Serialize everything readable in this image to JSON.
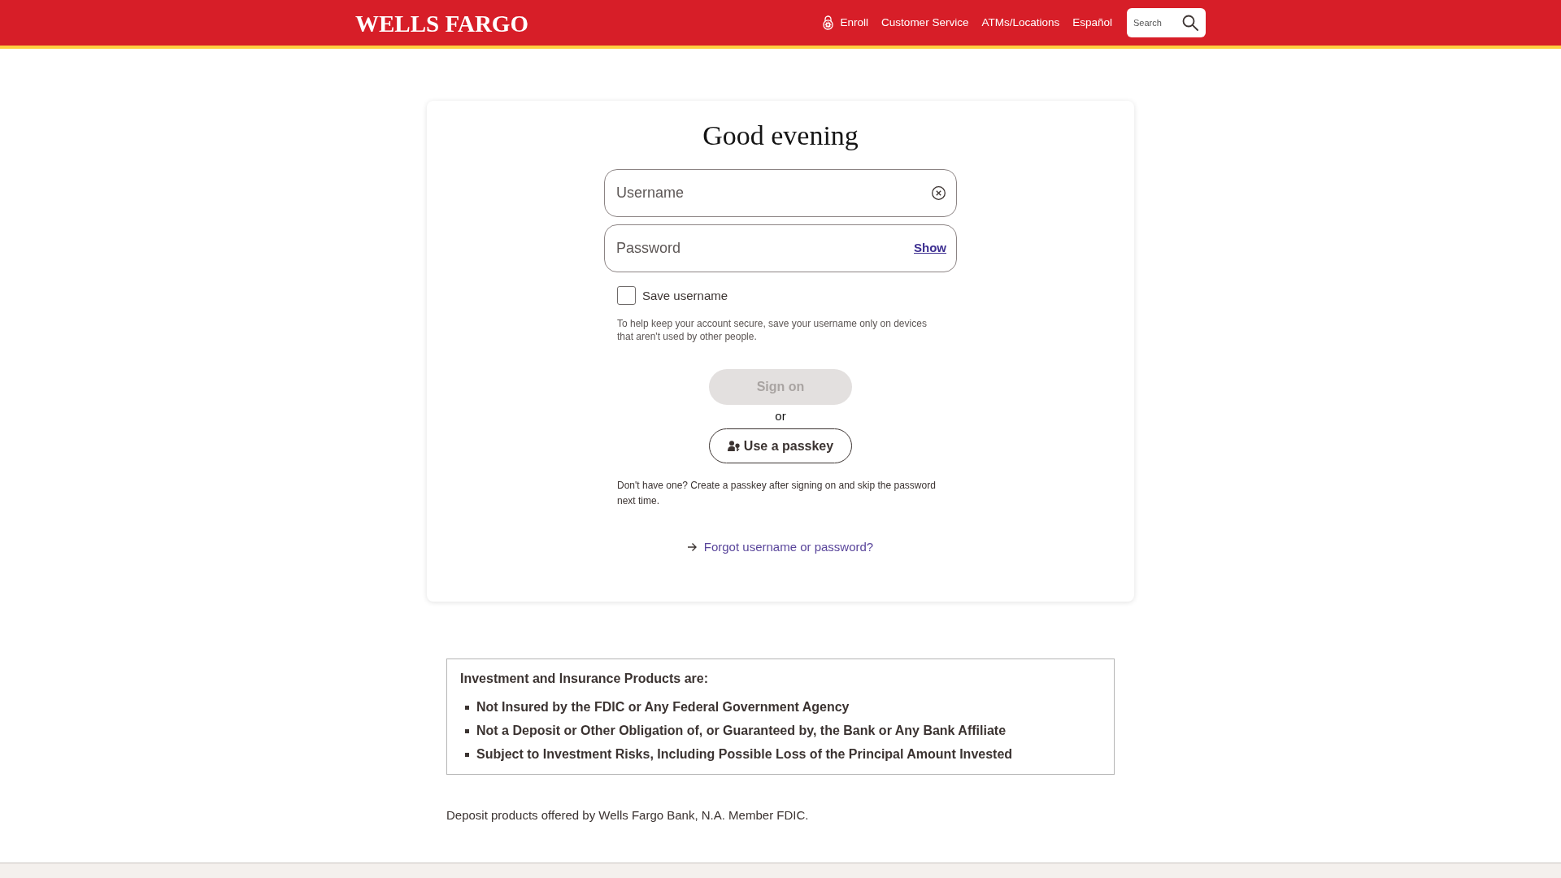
{
  "header": {
    "logo": "WELLS FARGO",
    "nav": [
      {
        "label": "Enroll",
        "kind": "icon"
      },
      {
        "label": "Customer Service",
        "kind": "text"
      },
      {
        "label": "ATMs/Locations",
        "kind": "text"
      },
      {
        "label": "Español",
        "kind": "text"
      }
    ],
    "search": {
      "placeholder": "Search"
    }
  },
  "signin": {
    "greeting": "Good evening",
    "username": {
      "placeholder": "Username"
    },
    "password": {
      "placeholder": "Password",
      "toggle": "Show"
    },
    "save_username": {
      "label": "Save username",
      "checked": false
    },
    "save_hint": "To help keep your account secure, save your username only on devices that aren't used by other people.",
    "sign_on": {
      "label": "Sign on",
      "disabled": true
    },
    "separator": "or",
    "passkey": {
      "label": "Use a passkey"
    },
    "passkey_hint": "Don't have one? Create a passkey after signing on and skip the password next time.",
    "forgot_link": "Forgot username or password?"
  },
  "disclosure": {
    "heading": "Investment and Insurance Products are:",
    "items": [
      "Not Insured by the FDIC or Any Federal Government Agency",
      "Not a Deposit or Other Obligation of, or Guaranteed by, the Bank or Any Bank Affiliate",
      "Subject to Investment Risks, Including Possible Loss of the Principal Amount Invested"
    ]
  },
  "footer_note": "Deposit products offered by Wells Fargo Bank, N.A. Member FDIC."
}
